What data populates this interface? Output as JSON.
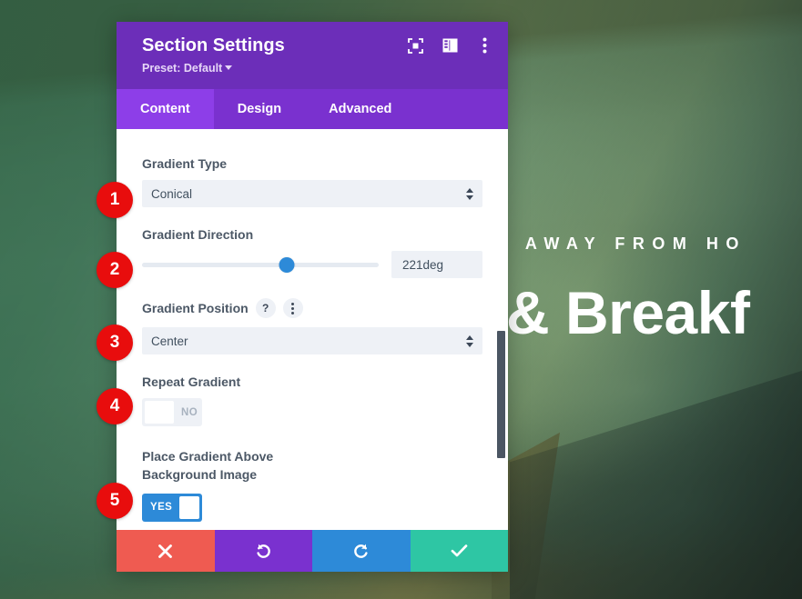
{
  "background": {
    "eyebrow": "ME AWAY FROM HO",
    "headline": "& Breakf"
  },
  "modal": {
    "title": "Section Settings",
    "preset": "Preset: Default",
    "header_icons": [
      {
        "name": "focus-icon"
      },
      {
        "name": "layout-panel-icon"
      },
      {
        "name": "more-options-icon"
      }
    ],
    "tabs": [
      {
        "label": "Content",
        "active": true
      },
      {
        "label": "Design",
        "active": false
      },
      {
        "label": "Advanced",
        "active": false
      }
    ],
    "fields": {
      "gradient_type": {
        "label": "Gradient Type",
        "value": "Conical"
      },
      "gradient_direction": {
        "label": "Gradient Direction",
        "value": "221deg",
        "slider_percent": 61
      },
      "gradient_position": {
        "label": "Gradient Position",
        "value": "Center",
        "help_icon": "?"
      },
      "repeat_gradient": {
        "label": "Repeat Gradient",
        "state": "NO"
      },
      "place_gradient_above": {
        "label": "Place Gradient Above Background Image",
        "state": "YES"
      }
    },
    "footer": [
      {
        "name": "cancel-button",
        "icon": "close-icon"
      },
      {
        "name": "undo-button",
        "icon": "undo-icon"
      },
      {
        "name": "redo-button",
        "icon": "redo-icon"
      },
      {
        "name": "save-button",
        "icon": "check-icon"
      }
    ]
  },
  "callouts": [
    {
      "number": "1"
    },
    {
      "number": "2"
    },
    {
      "number": "3"
    },
    {
      "number": "4"
    },
    {
      "number": "5"
    }
  ],
  "colors": {
    "header_purple": "#6c2eb9",
    "tab_bar_purple": "#7a31cf",
    "tab_active_purple": "#8d3ee8",
    "toggle_on_blue": "#2d8ad8",
    "slider_blue": "#2d8ad8",
    "badge_red": "#e80d0d",
    "cancel_red": "#ef5b51",
    "save_teal": "#2ec6a4"
  }
}
